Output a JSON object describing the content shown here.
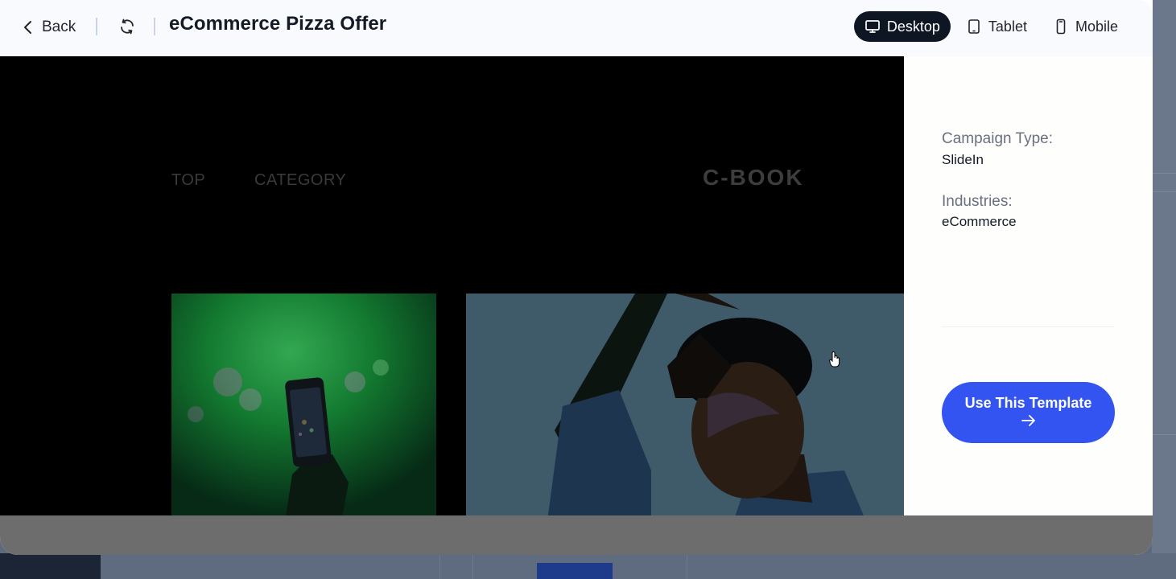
{
  "header": {
    "back_label": "Back",
    "title": "eCommerce Pizza Offer",
    "devices": [
      {
        "label": "Desktop",
        "icon": "desktop-icon",
        "active": true
      },
      {
        "label": "Tablet",
        "icon": "tablet-icon",
        "active": false
      },
      {
        "label": "Mobile",
        "icon": "mobile-icon",
        "active": false
      }
    ]
  },
  "preview": {
    "nav_top": "TOP",
    "nav_category": "CATEGORY",
    "logo": "C-BOOK"
  },
  "side": {
    "campaign_type_label": "Campaign Type:",
    "campaign_type_value": "SlideIn",
    "industries_label": "Industries:",
    "industries_value": "eCommerce",
    "cta_label": "Use This Template"
  },
  "colors": {
    "accent": "#3354f0",
    "active_device_bg": "#0f1623"
  }
}
